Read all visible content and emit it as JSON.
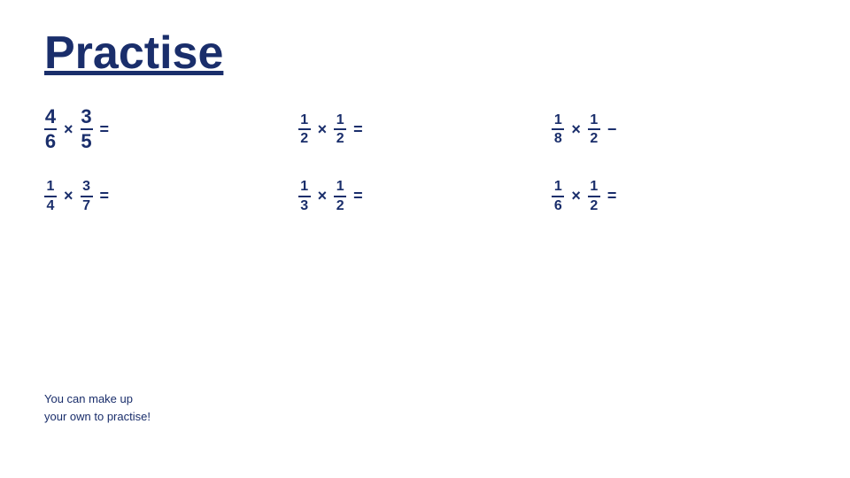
{
  "title": "Practise",
  "problems": [
    {
      "id": "p1",
      "num1": "4",
      "den1": "6",
      "num2": "3",
      "den2": "5",
      "operator": "×",
      "trailing": "="
    },
    {
      "id": "p2",
      "num1": "1",
      "den1": "2",
      "num2": "1",
      "den2": "2",
      "operator": "×",
      "trailing": "="
    },
    {
      "id": "p3",
      "num1": "1",
      "den1": "8",
      "num2": "1",
      "den2": "2",
      "operator": "×",
      "trailing": "−"
    },
    {
      "id": "p4",
      "num1": "1",
      "den1": "4",
      "num2": "3",
      "den2": "7",
      "operator": "×",
      "trailing": "="
    },
    {
      "id": "p5",
      "num1": "1",
      "den1": "3",
      "num2": "1",
      "den2": "2",
      "operator": "×",
      "trailing": "="
    },
    {
      "id": "p6",
      "num1": "1",
      "den1": "6",
      "num2": "1",
      "den2": "2",
      "operator": "×",
      "trailing": "="
    }
  ],
  "note_line1": "You can make up",
  "note_line2": "your own to practise!"
}
